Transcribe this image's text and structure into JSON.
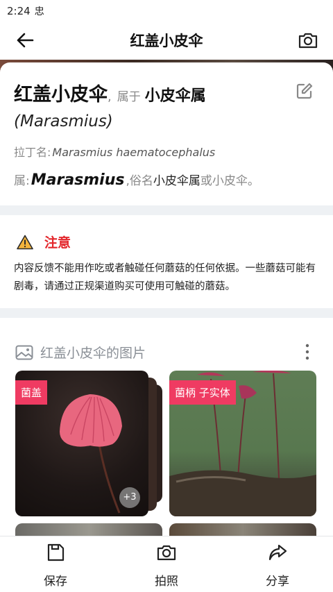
{
  "status_bar": {
    "time": "2:24",
    "notification_glyph": "忠"
  },
  "app_bar": {
    "title": "红盖小皮伞",
    "back_icon": "arrow-left-icon",
    "camera_icon": "camera-icon"
  },
  "species": {
    "common_name": "红盖小皮伞",
    "separator": ",",
    "belongs_label": "属于",
    "genus_common": "小皮伞属",
    "genus_latin_paren": "(Marasmius)",
    "latin_label": "拉丁名:",
    "latin_name": "Marasmius haematocephalus",
    "genus_label": "属:",
    "genus_latin": "Marasmius",
    "alias_prefix": ",俗名",
    "alias_1": "小皮伞属",
    "alias_join": "或",
    "alias_2": "小皮伞。"
  },
  "warning": {
    "title": "注意",
    "text": "内容反馈不能用作吃或者触碰任何蘑菇的任何依据。一些蘑菇可能有剧毒，请通过正规渠道购买可使用可触碰的蘑菇。",
    "icon": "warning-icon",
    "color": "#e3262b"
  },
  "photos": {
    "title": "红盖小皮伞的图片",
    "tiles": [
      {
        "tag": "菌盖",
        "more_count": "+3"
      },
      {
        "tag": "菌柄 子实体"
      }
    ]
  },
  "bottom_nav": [
    {
      "label": "保存",
      "icon": "save-icon"
    },
    {
      "label": "拍照",
      "icon": "camera-icon"
    },
    {
      "label": "分享",
      "icon": "share-icon"
    }
  ],
  "colors": {
    "accent_tag": "#ef3b62",
    "warning": "#e3262b"
  }
}
